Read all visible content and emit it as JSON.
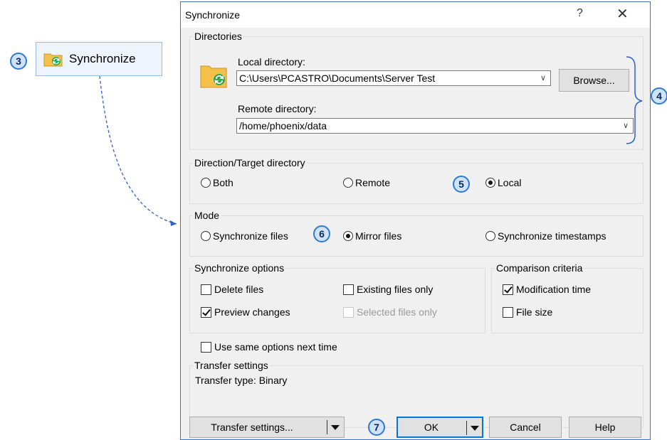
{
  "callouts": {
    "c3": "3",
    "c4": "4",
    "c5": "5",
    "c6": "6",
    "c7": "7"
  },
  "external_button": {
    "label": "Synchronize",
    "icon": "sync-folder-icon"
  },
  "dialog": {
    "title": "Synchronize",
    "help_glyph": "?",
    "close_glyph": "✕",
    "directories": {
      "legend": "Directories",
      "local_label": "Local directory:",
      "local_value": "C:\\Users\\PCASTRO\\Documents\\Server Test",
      "browse_label": "Browse...",
      "remote_label": "Remote directory:",
      "remote_value": "/home/phoenix/data"
    },
    "direction": {
      "legend": "Direction/Target directory",
      "options": [
        "Both",
        "Remote",
        "Local"
      ],
      "selected": "Local"
    },
    "mode": {
      "legend": "Mode",
      "options": [
        "Synchronize files",
        "Mirror files",
        "Synchronize timestamps"
      ],
      "selected": "Mirror files"
    },
    "sync_options": {
      "legend": "Synchronize options",
      "delete_files": "Delete files",
      "existing_files_only": "Existing files only",
      "preview_changes": "Preview changes",
      "selected_files_only": "Selected files only"
    },
    "comparison": {
      "legend": "Comparison criteria",
      "modification_time": "Modification time",
      "file_size": "File size"
    },
    "use_same_options": "Use same options next time",
    "transfer": {
      "legend": "Transfer settings",
      "type_text": "Transfer type: Binary"
    },
    "buttons": {
      "transfer_settings": "Transfer settings...",
      "ok": "OK",
      "cancel": "Cancel",
      "help": "Help"
    }
  },
  "colors": {
    "accent": "#0078d7",
    "callout_fill": "#cfe3f8",
    "callout_border": "#2f77d1",
    "dialog_bg": "#f0f0f0"
  }
}
